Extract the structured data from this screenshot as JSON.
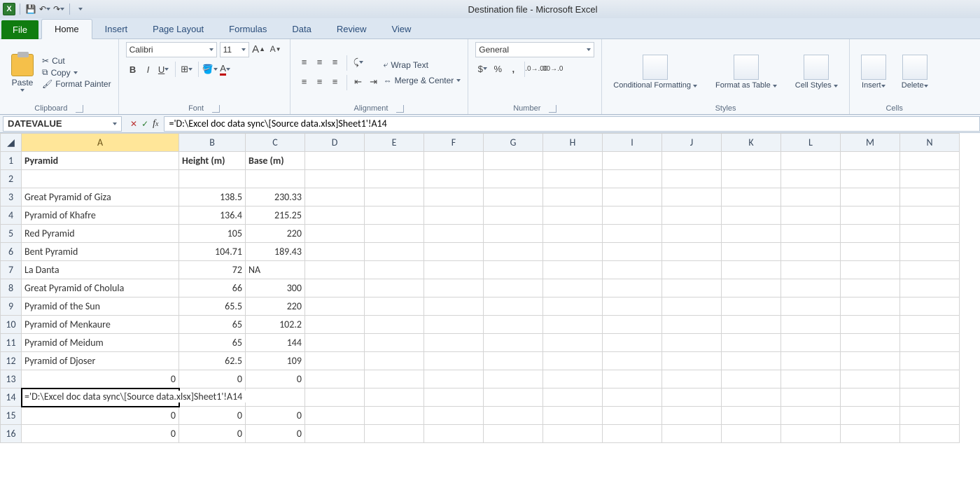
{
  "window": {
    "title": "Destination file  -  Microsoft Excel"
  },
  "qat": {
    "save": "save-icon",
    "undo": "undo-icon",
    "redo": "redo-icon"
  },
  "tabs": {
    "file": "File",
    "items": [
      "Home",
      "Insert",
      "Page Layout",
      "Formulas",
      "Data",
      "Review",
      "View"
    ],
    "active": "Home"
  },
  "ribbon": {
    "clipboard": {
      "paste": "Paste",
      "cut": "Cut",
      "copy": "Copy",
      "format_painter": "Format Painter",
      "label": "Clipboard"
    },
    "font": {
      "name": "Calibri",
      "size": "11",
      "label": "Font"
    },
    "alignment": {
      "wrap": "Wrap Text",
      "merge": "Merge & Center",
      "label": "Alignment"
    },
    "number": {
      "format": "General",
      "label": "Number"
    },
    "styles": {
      "cond": "Conditional Formatting",
      "table": "Format as Table",
      "cell": "Cell Styles",
      "label": "Styles"
    },
    "cells": {
      "insert": "Insert",
      "delete": "Delete",
      "label": "Cells"
    }
  },
  "namebox": "DATEVALUE",
  "formula": "='D:\\Excel doc data sync\\[Source data.xlsx]Sheet1'!A14",
  "columns": [
    "A",
    "B",
    "C",
    "D",
    "E",
    "F",
    "G",
    "H",
    "I",
    "J",
    "K",
    "L",
    "M",
    "N"
  ],
  "headers": {
    "a": "Pyramid",
    "b": "Height (m)",
    "c": "Base (m)"
  },
  "rows": [
    {
      "r": 3,
      "a": "Great Pyramid of Giza",
      "b": "138.5",
      "c": "230.33"
    },
    {
      "r": 4,
      "a": "Pyramid of Khafre",
      "b": "136.4",
      "c": "215.25"
    },
    {
      "r": 5,
      "a": "Red Pyramid",
      "b": "105",
      "c": "220"
    },
    {
      "r": 6,
      "a": "Bent Pyramid",
      "b": "104.71",
      "c": "189.43"
    },
    {
      "r": 7,
      "a": "La Danta",
      "b": "72",
      "c": "NA",
      "c_align": "left"
    },
    {
      "r": 8,
      "a": "Great Pyramid of Cholula",
      "b": "66",
      "c": "300"
    },
    {
      "r": 9,
      "a": "Pyramid of the Sun",
      "b": "65.5",
      "c": "220"
    },
    {
      "r": 10,
      "a": "Pyramid of Menkaure",
      "b": "65",
      "c": "102.2"
    },
    {
      "r": 11,
      "a": "Pyramid of Meidum",
      "b": "65",
      "c": "144"
    },
    {
      "r": 12,
      "a": "Pyramid of Djoser",
      "b": "62.5",
      "c": "109"
    }
  ],
  "zeros": [
    {
      "r": 13,
      "a": "0",
      "b": "0",
      "c": "0"
    },
    {
      "r": 15,
      "a": "0",
      "b": "0",
      "c": "0"
    },
    {
      "r": 16,
      "a": "0",
      "b": "0",
      "c": "0"
    }
  ],
  "editcell": {
    "r": 14,
    "text": "='D:\\Excel doc data sync\\[Source data.xlsx]Sheet1'!A14"
  }
}
